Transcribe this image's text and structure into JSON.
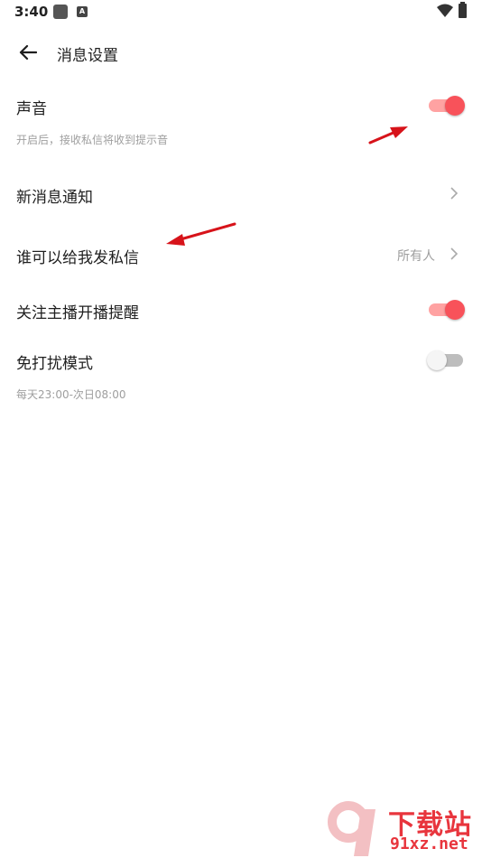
{
  "status_bar": {
    "time": "3:40",
    "notification_icons": [
      "square-icon",
      "a-icon"
    ],
    "a_icon_letter": "A",
    "right_icons": [
      "wifi-icon",
      "battery-icon"
    ]
  },
  "header": {
    "back_icon": "arrow-left-icon",
    "title": "消息设置"
  },
  "settings": {
    "sound": {
      "label": "声音",
      "subtitle": "开启后，接收私信将收到提示音",
      "enabled": true
    },
    "new_message_notification": {
      "label": "新消息通知"
    },
    "who_can_message": {
      "label": "谁可以给我发私信",
      "value": "所有人"
    },
    "follow_stream_reminder": {
      "label": "关注主播开播提醒",
      "enabled": true
    },
    "do_not_disturb": {
      "label": "免打扰模式",
      "subtitle": "每天23:00-次日08:00",
      "enabled": false
    }
  },
  "colors": {
    "accent": "#f8525a",
    "accent_track": "#ffa2a2",
    "off_track": "#bdbdbd",
    "annotation_arrow": "#d7131a"
  },
  "watermark": {
    "logo_text": "9f",
    "title": "下载站",
    "url": "91xz.net"
  }
}
